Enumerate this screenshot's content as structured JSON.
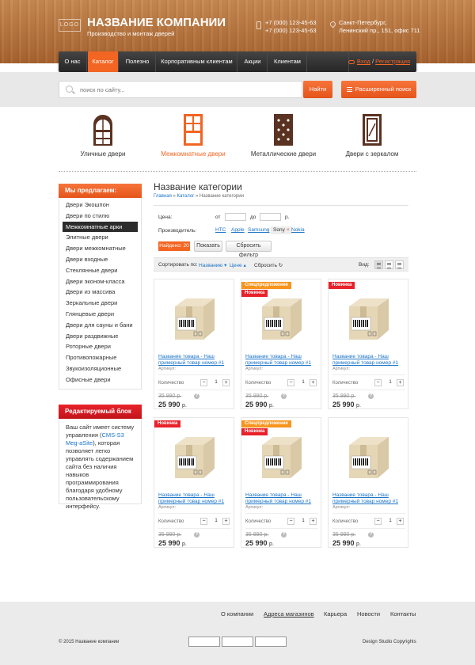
{
  "header": {
    "logo": "LOGO",
    "company": "НАЗВАНИЕ КОМПАНИИ",
    "tagline": "Производство и монтаж дверей",
    "phone1": "+7 (000) 123-45-63",
    "phone2": "+7 (000) 123-45-63",
    "city": "Санкт-Петербург,",
    "street": "Ленинский пр., 151, офис 711"
  },
  "nav": {
    "items": [
      "О нас",
      "Каталог",
      "Полезно",
      "Корпоративным клиентам",
      "Акции",
      "Клиентам"
    ],
    "login": "Вход",
    "sep": "/",
    "register": "Регистрация"
  },
  "search": {
    "placeholder": "поиск по сайту...",
    "button": "Найти",
    "advanced": "Расширенный поиск"
  },
  "categories": [
    "Уличные двери",
    "Межкомнатные двери",
    "Металлические двери",
    "Двери с зеркалом"
  ],
  "sidebar": {
    "title": "Мы предлагаем:",
    "items": [
      "Двери Экошпон",
      "Двери по стилю",
      "Межкомнатные арки",
      "Элитные двери",
      "Двери межкомнатные",
      "Двери входные",
      "Стеклянные двери",
      "Двери эконом-класса",
      "Двери из массива",
      "Зеркальные двери",
      "Глянцевые двери",
      "Двери для сауны и бани",
      "Двери раздвижные",
      "Роторные двери",
      "Противопожарные",
      "Звукоизоляционные",
      "Офисные двери"
    ],
    "block_title": "Редактируемый блок",
    "block_text_1": "Ваш сайт имеет систему управления (",
    "block_link": "CMS-S3 Meg-aSite",
    "block_text_2": "), которая позволяет легко управлять содержанием сайта без наличия навыков программирования благодаря удобному пользовательскому интерфейсу."
  },
  "main": {
    "title": "Название категории",
    "crumb_home": "Главная",
    "crumb_sep": "»",
    "crumb_catalog": "Каталог",
    "crumb_current": "Название категории",
    "filter": {
      "price_label": "Цена:",
      "from": "от",
      "to": "до",
      "currency": "р.",
      "maker_label": "Производитель:",
      "makers": [
        "HTC",
        "Apple",
        "Samsung",
        "Sony",
        "Nokia"
      ],
      "remove": "×",
      "found": "Найдено: 20",
      "show": "Показать",
      "reset": "Сбросить фильтр"
    },
    "sort": {
      "label": "Сортировать по:",
      "by_name": "Названию",
      "by_price": "Цене",
      "reset": "Сбросить",
      "view": "Вид:"
    }
  },
  "products": [
    {
      "badges": [],
      "name": "Название товара - Наш примерный товар номер #1",
      "article": "Артикул:",
      "qty_label": "Количество",
      "qty": "1",
      "minus": "−",
      "plus": "+",
      "old_price": "35 990 р.",
      "q": "?",
      "price": "25 990",
      "cur": "р."
    },
    {
      "badges": [
        "Спецпредложение",
        "Новинка"
      ],
      "name": "Название товара - Наш примерный товар номер #1",
      "article": "Артикул:",
      "qty_label": "Количество",
      "qty": "1",
      "minus": "−",
      "plus": "+",
      "old_price": "35 990 р.",
      "q": "?",
      "price": "25 990",
      "cur": "р."
    },
    {
      "badges": [
        "Новинка"
      ],
      "name": "Название товара - Наш примерный товар номер #1",
      "article": "Артикул:",
      "qty_label": "Количество",
      "qty": "1",
      "minus": "−",
      "plus": "+",
      "old_price": "35 990 р.",
      "q": "?",
      "price": "25 990",
      "cur": "р."
    },
    {
      "badges": [
        "Новинка"
      ],
      "name": "Название товара - Наш примерный товар номер #1",
      "article": "Артикул:",
      "qty_label": "Количество",
      "qty": "1",
      "minus": "−",
      "plus": "+",
      "old_price": "35 990 р.",
      "q": "?",
      "price": "25 990",
      "cur": "р."
    },
    {
      "badges": [
        "Спецпредложение",
        "Новинка"
      ],
      "name": "Название товара - Наш примерный товар номер #1",
      "article": "Артикул:",
      "qty_label": "Количество",
      "qty": "1",
      "minus": "−",
      "plus": "+",
      "old_price": "35 990 р.",
      "q": "?",
      "price": "25 990",
      "cur": "р."
    },
    {
      "badges": [],
      "name": "Название товара - Наш примерный товар номер #1",
      "article": "Артикул:",
      "qty_label": "Количество",
      "qty": "1",
      "minus": "−",
      "plus": "+",
      "old_price": "35 990 р.",
      "q": "?",
      "price": "25 990",
      "cur": "р."
    }
  ],
  "footer": {
    "links": [
      "О компании",
      "Адреса магазинов",
      "Карьера",
      "Новости",
      "Контакты"
    ],
    "copyright": "© 2015 Название компании",
    "studio": "Design Studio Copyrights"
  },
  "colors": {
    "accent": "#f26522",
    "badge_new": "#e8222a",
    "badge_special": "#f7941d",
    "link": "#1a73c8",
    "door": "#5a3222"
  }
}
